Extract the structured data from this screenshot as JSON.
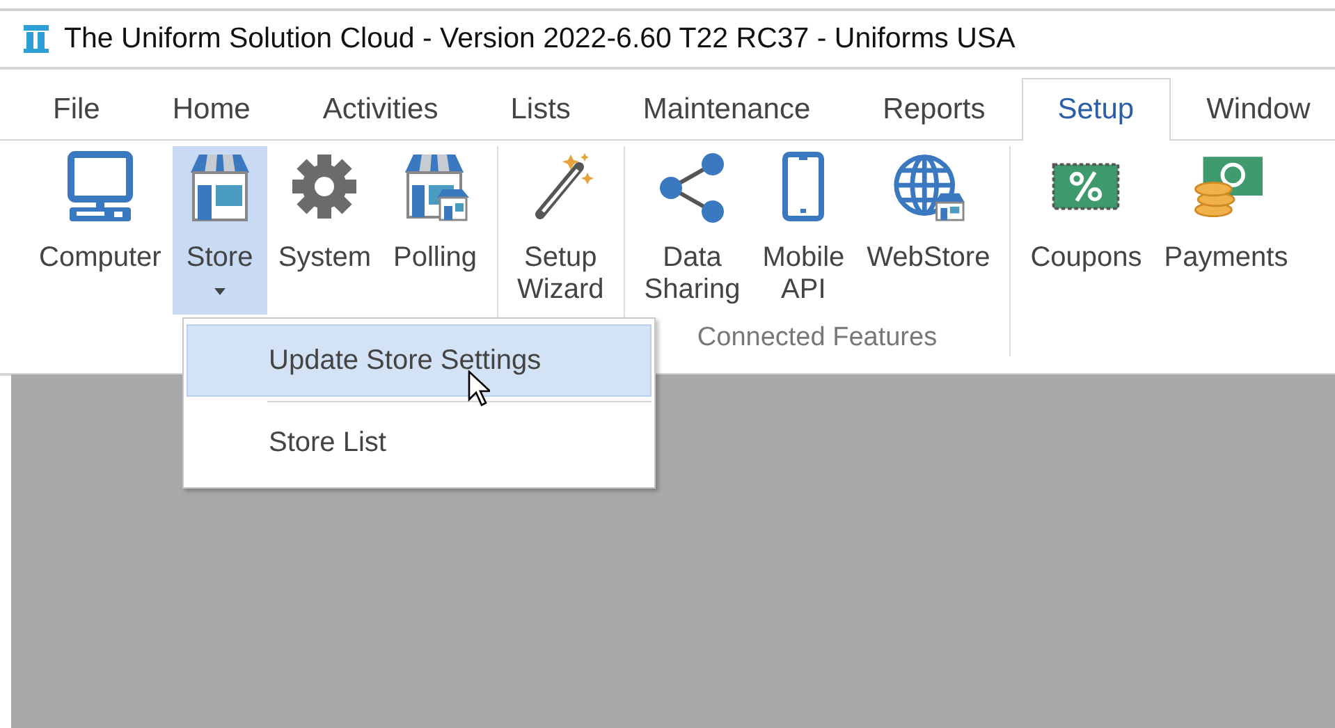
{
  "window": {
    "title": "The Uniform Solution Cloud - Version 2022-6.60 T22 RC37 - Uniforms USA"
  },
  "tabs": [
    {
      "label": "File",
      "selected": false
    },
    {
      "label": "Home",
      "selected": false
    },
    {
      "label": "Activities",
      "selected": false
    },
    {
      "label": "Lists",
      "selected": false
    },
    {
      "label": "Maintenance",
      "selected": false
    },
    {
      "label": "Reports",
      "selected": false
    },
    {
      "label": "Setup",
      "selected": true
    },
    {
      "label": "Window",
      "selected": false
    }
  ],
  "ribbon": {
    "groups": [
      {
        "buttons": [
          {
            "kind": "computer",
            "lines": [
              "Computer"
            ],
            "selected": false,
            "dropdown": false
          },
          {
            "kind": "store",
            "lines": [
              "Store"
            ],
            "selected": true,
            "dropdown": true
          },
          {
            "kind": "gear",
            "lines": [
              "System"
            ],
            "selected": false,
            "dropdown": false
          },
          {
            "kind": "stores",
            "lines": [
              "Polling"
            ],
            "selected": false,
            "dropdown": false
          }
        ]
      },
      {
        "buttons": [
          {
            "kind": "wand",
            "lines": [
              "Setup",
              "Wizard"
            ],
            "selected": false,
            "dropdown": false
          }
        ]
      },
      {
        "label": "Connected Features",
        "buttons": [
          {
            "kind": "share",
            "lines": [
              "Data",
              "Sharing"
            ],
            "selected": false,
            "dropdown": false
          },
          {
            "kind": "phone",
            "lines": [
              "Mobile",
              "API"
            ],
            "selected": false,
            "dropdown": false
          },
          {
            "kind": "globe",
            "lines": [
              "WebStore"
            ],
            "selected": false,
            "dropdown": false
          }
        ]
      },
      {
        "buttons": [
          {
            "kind": "coupon",
            "lines": [
              "Coupons"
            ],
            "selected": false,
            "dropdown": false
          },
          {
            "kind": "payment",
            "lines": [
              "Payments"
            ],
            "selected": false,
            "dropdown": false
          }
        ]
      }
    ]
  },
  "menu": {
    "items": [
      {
        "label": "Update Store Settings",
        "selected": true
      },
      {
        "label": "Store List",
        "selected": false
      }
    ]
  }
}
